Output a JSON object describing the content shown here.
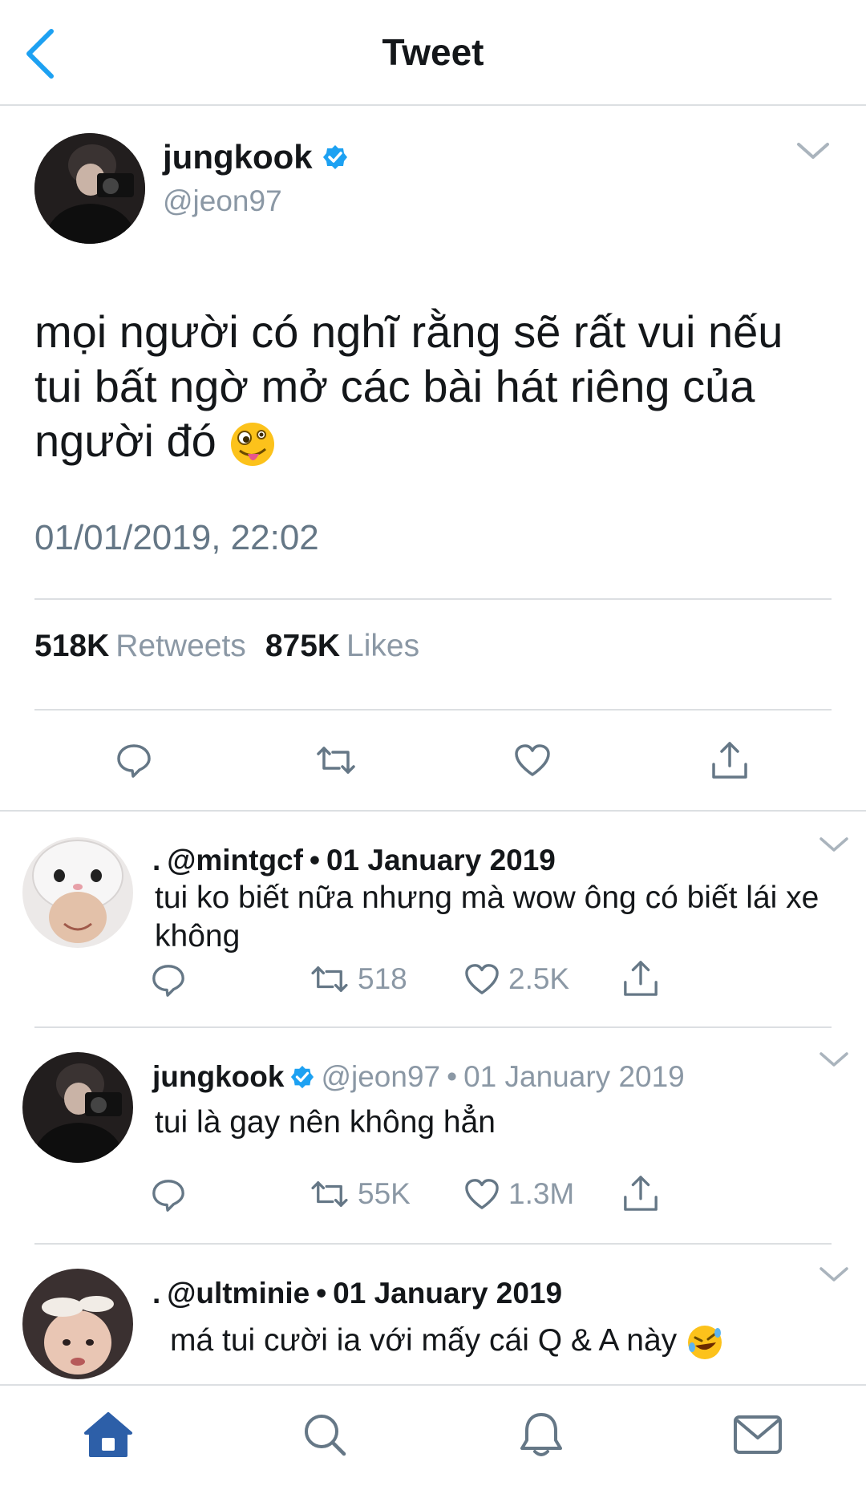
{
  "header": {
    "title": "Tweet"
  },
  "main_tweet": {
    "name": "jungkook",
    "handle": "@jeon97",
    "text": "mọi người có nghĩ rằng sẽ rất vui nếu tui bất ngờ mở các bài hát riêng của người đó",
    "timestamp": "01/01/2019, 22:02",
    "retweets_count": "518K",
    "retweets_label": "Retweets",
    "likes_count": "875K",
    "likes_label": "Likes"
  },
  "replies": [
    {
      "prefix": ".",
      "handle": "@mintgcf",
      "sep": "•",
      "date": "01 January 2019",
      "text": "tui ko biết nữa nhưng mà wow ông có biết lái xe không",
      "retweets": "518",
      "likes": "2.5K"
    },
    {
      "name": "jungkook",
      "handle": "@jeon97",
      "sep": "•",
      "date": "01 January 2019",
      "text": "tui là gay nên không hẳn",
      "retweets": "55K",
      "likes": "1.3M"
    },
    {
      "prefix": ".",
      "handle": "@ultminie",
      "sep": "•",
      "date": "01 January 2019",
      "text": "má tui cười ia với mấy cái Q & A này"
    }
  ],
  "colors": {
    "accent": "#1da1f2",
    "tab_active": "#2d5fa8",
    "muted": "#8b98a5",
    "divider": "#dcdfe2"
  },
  "icons": {
    "back": "chevron-left-icon",
    "verified": "verified-badge-icon",
    "reply": "reply-icon",
    "retweet": "retweet-icon",
    "like": "heart-icon",
    "share": "share-icon",
    "tabs": [
      "home-icon",
      "search-icon",
      "bell-icon",
      "mail-icon"
    ]
  }
}
